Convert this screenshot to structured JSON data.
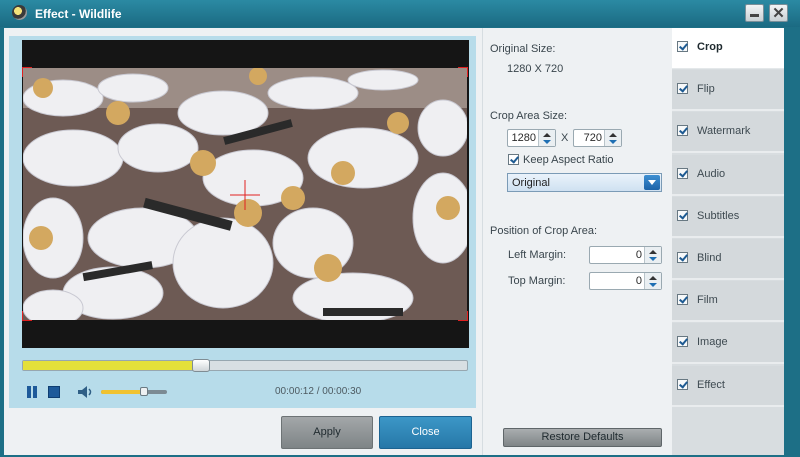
{
  "window": {
    "title": "Effect - Wildlife",
    "minimize_icon": "minimize-icon",
    "close_icon": "close-icon",
    "close_glyph": "✕"
  },
  "player": {
    "time": "00:00:12 / 00:00:30",
    "progress": 0.4,
    "volume": 0.65,
    "pause_icon": "pause-icon",
    "stop_icon": "stop-icon",
    "volume_icon": "speaker-icon",
    "accent_color": "#e4e03a"
  },
  "buttons": {
    "apply": "Apply",
    "close": "Close",
    "restore": "Restore Defaults"
  },
  "crop": {
    "original_size_label": "Original Size:",
    "original_size_value": "1280 X 720",
    "crop_area_label": "Crop Area Size:",
    "width": "1280",
    "separator": "X",
    "height": "720",
    "keep_aspect_label": "Keep Aspect Ratio",
    "keep_aspect_checked": true,
    "aspect_selected": "Original",
    "position_label": "Position of Crop Area:",
    "left_margin_label": "Left Margin:",
    "left_margin_value": "0",
    "top_margin_label": "Top Margin:",
    "top_margin_value": "0"
  },
  "tabs": [
    {
      "label": "Crop",
      "checked": true,
      "active": true
    },
    {
      "label": "Flip",
      "checked": true,
      "active": false
    },
    {
      "label": "Watermark",
      "checked": true,
      "active": false
    },
    {
      "label": "Audio",
      "checked": true,
      "active": false
    },
    {
      "label": "Subtitles",
      "checked": true,
      "active": false
    },
    {
      "label": "Blind",
      "checked": true,
      "active": false
    },
    {
      "label": "Film",
      "checked": true,
      "active": false
    },
    {
      "label": "Image",
      "checked": true,
      "active": false
    },
    {
      "label": "Effect",
      "checked": true,
      "active": false
    }
  ]
}
